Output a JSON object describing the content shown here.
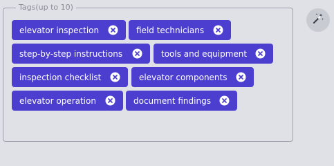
{
  "tags_field": {
    "legend": "Tags(up to 10)",
    "tags": [
      {
        "label": "elevator inspection"
      },
      {
        "label": "field technicians"
      },
      {
        "label": "step-by-step instructions"
      },
      {
        "label": "tools and equipment"
      },
      {
        "label": "inspection checklist"
      },
      {
        "label": "elevator components"
      },
      {
        "label": "elevator operation"
      },
      {
        "label": "document findings"
      }
    ]
  },
  "magic_button": {
    "icon": "magic-wand-icon"
  },
  "colors": {
    "background": "#dfe1e6",
    "chip": "#4c3fcf",
    "chip_text": "#ffffff",
    "border": "#9ea0ad",
    "legend_text": "#8a8c98"
  }
}
